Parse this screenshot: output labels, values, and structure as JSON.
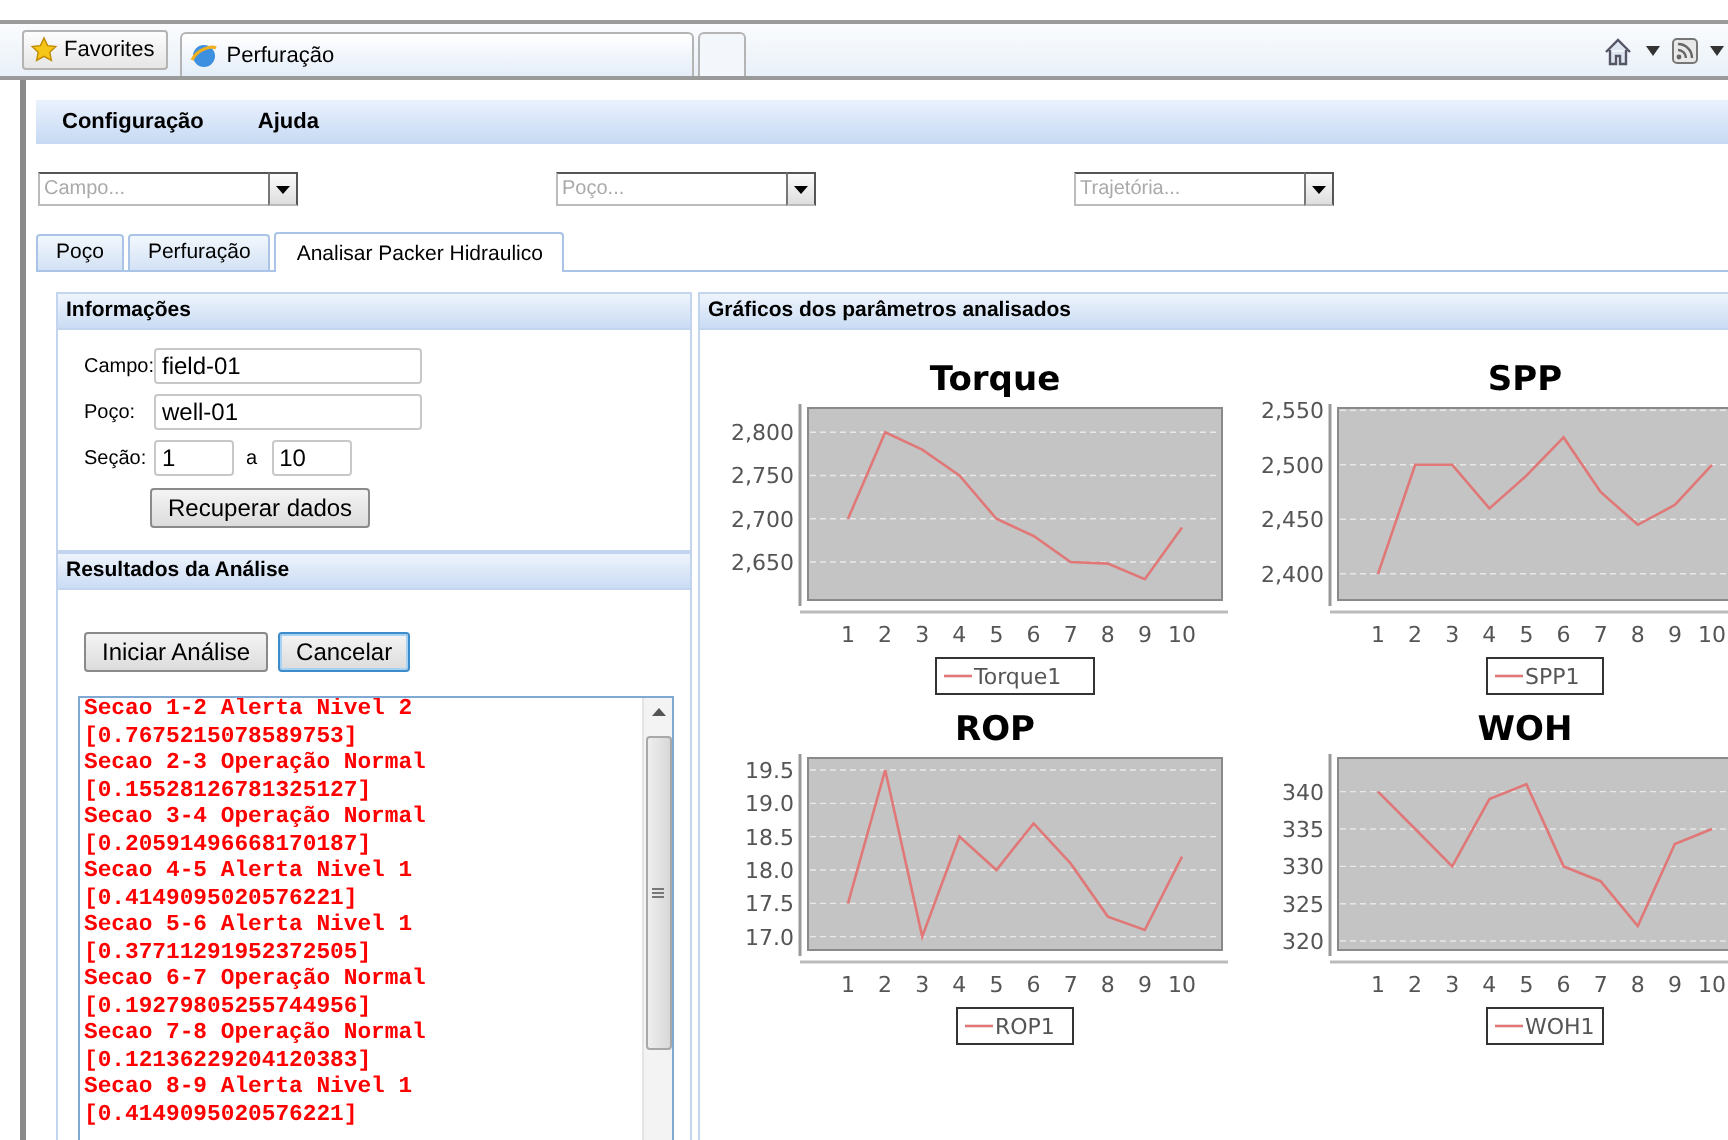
{
  "browser": {
    "favorites": "Favorites",
    "tab_title": "Perfuração"
  },
  "menu": [
    {
      "label": "Configuração"
    },
    {
      "label": "Ajuda"
    }
  ],
  "filters": [
    {
      "placeholder": "Campo..."
    },
    {
      "placeholder": "Poço..."
    },
    {
      "placeholder": "Trajetória..."
    }
  ],
  "tabs": [
    {
      "label": "Poço",
      "selected": false
    },
    {
      "label": "Perfuração",
      "selected": false
    },
    {
      "label": "Analisar Packer Hidraulico",
      "selected": true
    }
  ],
  "info": {
    "title": "Informações",
    "fields": [
      {
        "label": "Campo:",
        "value": "field-01"
      },
      {
        "label": "Poço:",
        "value": "well-01"
      }
    ],
    "section": {
      "label": "Seção:",
      "from": "1",
      "separator": "a",
      "to": "10"
    },
    "button": "Recuperar dados"
  },
  "results": {
    "title": "Resultados da Análise",
    "buttons": [
      {
        "label": "Iniciar Análise",
        "focused": false
      },
      {
        "label": "Cancelar",
        "focused": true
      }
    ],
    "lines": [
      "Secao 1-2 Alerta Nivel 2",
      "[0.7675215078589753]",
      "Secao 2-3 Operação Normal",
      "[0.15528126781325127]",
      "Secao 3-4 Operação Normal",
      "[0.20591496668170187]",
      "Secao 4-5 Alerta Nivel 1",
      "[0.4149095020576221]",
      "Secao 5-6 Alerta Nivel 1",
      "[0.37711291952372505]",
      "Secao 6-7 Operação Normal",
      "[0.19279805255744956]",
      "Secao 7-8 Operação Normal",
      "[0.12136229204120383]",
      "Secao 8-9 Alerta Nivel 1",
      "[0.4149095020576221]"
    ]
  },
  "charts": {
    "title": "Gráficos dos parâmetros analisados",
    "items": [
      {
        "chart_data": {
          "type": "line",
          "grid": true,
          "title": "Torque",
          "categories": [
            "1",
            "2",
            "3",
            "4",
            "5",
            "6",
            "7",
            "8",
            "9",
            "10"
          ],
          "ylim": [
            2606,
            2828
          ],
          "yticks": [
            {
              "value": 2650,
              "label": "2,650"
            },
            {
              "value": 2700,
              "label": "2,700"
            },
            {
              "value": 2750,
              "label": "2,750"
            },
            {
              "value": 2800,
              "label": "2,800"
            }
          ],
          "series": [
            {
              "name": "Torque1",
              "color": "#e07878",
              "values": [
                2700,
                2800,
                2780,
                2750,
                2700,
                2680,
                2650,
                2648,
                2630,
                2690
              ]
            }
          ]
        }
      },
      {
        "chart_data": {
          "type": "line",
          "grid": true,
          "title": "SPP",
          "categories": [
            "1",
            "2",
            "3",
            "4",
            "5",
            "6",
            "7",
            "8",
            "9",
            "10"
          ],
          "ylim": [
            2376,
            2552
          ],
          "yticks": [
            {
              "value": 2400,
              "label": "2,400"
            },
            {
              "value": 2450,
              "label": "2,450"
            },
            {
              "value": 2500,
              "label": "2,500"
            },
            {
              "value": 2550,
              "label": "2,550"
            }
          ],
          "series": [
            {
              "name": "SPP1",
              "color": "#e07878",
              "values": [
                2400,
                2500,
                2500,
                2460,
                2490,
                2525,
                2475,
                2445,
                2463,
                2500
              ]
            }
          ]
        }
      },
      {
        "chart_data": {
          "type": "line",
          "grid": true,
          "title": "ROP",
          "categories": [
            "1",
            "2",
            "3",
            "4",
            "5",
            "6",
            "7",
            "8",
            "9",
            "10"
          ],
          "ylim": [
            16.8,
            19.68
          ],
          "yticks": [
            {
              "value": 17,
              "label": "17.0"
            },
            {
              "value": 17.5,
              "label": "17.5"
            },
            {
              "value": 18,
              "label": "18.0"
            },
            {
              "value": 18.5,
              "label": "18.5"
            },
            {
              "value": 19,
              "label": "19.0"
            },
            {
              "value": 19.5,
              "label": "19.5"
            }
          ],
          "series": [
            {
              "name": "ROP1",
              "color": "#e07878",
              "values": [
                17.5,
                19.5,
                17.0,
                18.5,
                18.0,
                18.7,
                18.1,
                17.3,
                17.1,
                18.2
              ]
            }
          ]
        }
      },
      {
        "chart_data": {
          "type": "line",
          "grid": true,
          "title": "WOH",
          "categories": [
            "1",
            "2",
            "3",
            "4",
            "5",
            "6",
            "7",
            "8",
            "9",
            "10"
          ],
          "ylim": [
            318.8,
            344.5
          ],
          "yticks": [
            320,
            325,
            330,
            335,
            340
          ],
          "series": [
            {
              "name": "WOH1",
              "color": "#e07878",
              "values": [
                340,
                335,
                330,
                339,
                341,
                330,
                328,
                322,
                333,
                335
              ]
            }
          ]
        }
      }
    ]
  }
}
